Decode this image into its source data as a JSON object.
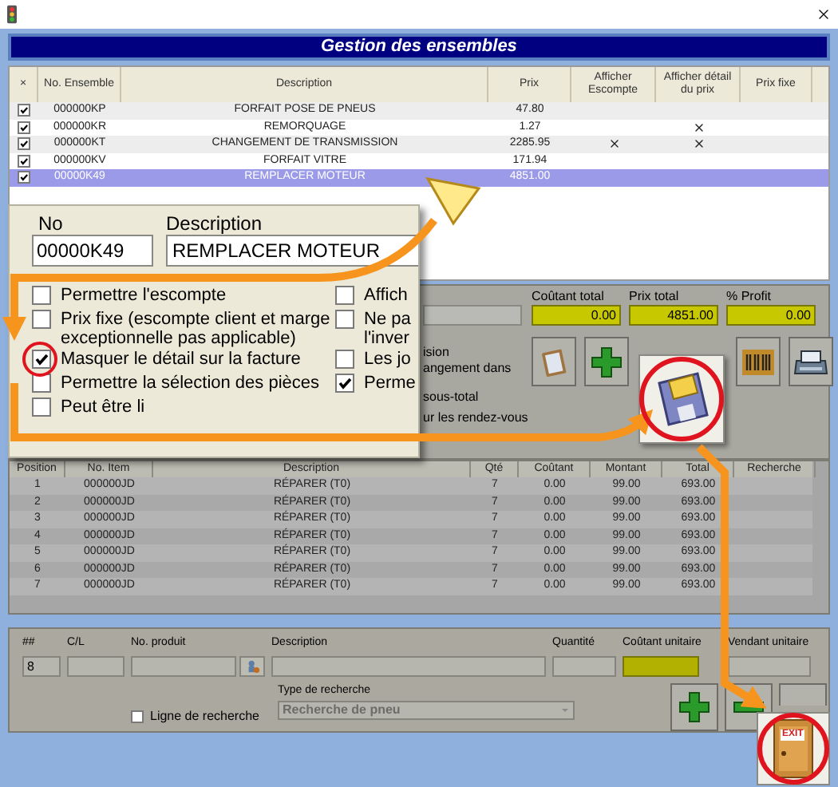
{
  "header": {
    "title": "Gestion des ensembles"
  },
  "table": {
    "columns": [
      "×",
      "No. Ensemble",
      "Description",
      "Prix",
      "Afficher Escompte",
      "Afficher détail du prix",
      "Prix fixe"
    ],
    "rows": [
      {
        "checked": true,
        "number": "000000KP",
        "description": "FORFAIT POSE DE PNEUS",
        "price": "47.80",
        "show_discount": false,
        "show_detail": false,
        "fixed_price": false,
        "selected": false
      },
      {
        "checked": true,
        "number": "000000KR",
        "description": "REMORQUAGE",
        "price": "1.27",
        "show_discount": false,
        "show_detail": true,
        "fixed_price": false,
        "selected": false
      },
      {
        "checked": true,
        "number": "000000KT",
        "description": "CHANGEMENT DE TRANSMISSION",
        "price": "2285.95",
        "show_discount": true,
        "show_detail": true,
        "fixed_price": false,
        "selected": false
      },
      {
        "checked": true,
        "number": "000000KV",
        "description": "FORFAIT VITRE",
        "price": "171.94",
        "show_discount": false,
        "show_detail": false,
        "fixed_price": false,
        "selected": false
      },
      {
        "checked": true,
        "number": "00000K49",
        "description": "REMPLACER MOTEUR",
        "price": "4851.00",
        "show_discount": false,
        "show_detail": false,
        "fixed_price": false,
        "selected": true
      }
    ]
  },
  "callout": {
    "number_label": "No",
    "number_value": "00000K49",
    "description_label": "Description",
    "description_value": "REMPLACER MOTEUR",
    "left_options": [
      {
        "lines": [
          "Permettre l'escompte"
        ],
        "checked": false
      },
      {
        "lines": [
          "Prix fixe (escompte client et marge",
          "exceptionnelle  pas applicable)"
        ],
        "checked": false
      },
      {
        "lines": [
          "Masquer le détail sur la facture"
        ],
        "checked": true
      },
      {
        "lines": [
          "Permettre la sélection des pièces"
        ],
        "checked": false
      },
      {
        "lines": [
          "Peut être li"
        ],
        "checked": false
      }
    ],
    "right_options": [
      {
        "lines": [
          "Affich"
        ],
        "checked": false
      },
      {
        "lines": [
          "Ne pa",
          "l'inver"
        ],
        "checked": false
      },
      {
        "lines": [
          "Les jo"
        ],
        "checked": false
      },
      {
        "lines": [
          "Perme"
        ],
        "checked": true
      }
    ]
  },
  "panel": {
    "notes": [
      "ision",
      "angement dans",
      "sous-total",
      "ur les rendez-vous"
    ],
    "totals": [
      {
        "label": "Coûtant total",
        "value": "0.00"
      },
      {
        "label": "Prix total",
        "value": "4851.00"
      },
      {
        "label": "% Profit",
        "value": "0.00"
      }
    ]
  },
  "grid": {
    "columns": [
      "Position",
      "No. Item",
      "Description",
      "Qté",
      "Coûtant",
      "Montant",
      "Total",
      "Recherche"
    ],
    "rows": [
      [
        "1",
        "000000JD",
        "RÉPARER (T0)",
        "7",
        "0.00",
        "99.00",
        "693.00",
        ""
      ],
      [
        "2",
        "000000JD",
        "RÉPARER (T0)",
        "7",
        "0.00",
        "99.00",
        "693.00",
        ""
      ],
      [
        "3",
        "000000JD",
        "RÉPARER (T0)",
        "7",
        "0.00",
        "99.00",
        "693.00",
        ""
      ],
      [
        "4",
        "000000JD",
        "RÉPARER (T0)",
        "7",
        "0.00",
        "99.00",
        "693.00",
        ""
      ],
      [
        "5",
        "000000JD",
        "RÉPARER (T0)",
        "7",
        "0.00",
        "99.00",
        "693.00",
        ""
      ],
      [
        "6",
        "000000JD",
        "RÉPARER (T0)",
        "7",
        "0.00",
        "99.00",
        "693.00",
        ""
      ],
      [
        "7",
        "000000JD",
        "RÉPARER (T0)",
        "7",
        "0.00",
        "99.00",
        "693.00",
        ""
      ]
    ]
  },
  "entry": {
    "fields": [
      {
        "kind": "plain",
        "label": "##",
        "value": "8"
      },
      {
        "kind": "plain",
        "label": "C/L"
      },
      {
        "kind": "lookup",
        "label": "No. produit"
      },
      {
        "kind": "plain",
        "label": "Description"
      },
      {
        "kind": "plain",
        "label": "Quantité"
      },
      {
        "kind": "highlight",
        "label": "Coûtant unitaire"
      },
      {
        "kind": "plain",
        "label": "Vendant unitaire"
      }
    ],
    "search_line": {
      "label": "Ligne de recherche",
      "checked": false
    },
    "search_type": {
      "label": "Type de recherche",
      "value": "Recherche de pneu"
    }
  },
  "exit": {
    "label": "EXIT"
  }
}
